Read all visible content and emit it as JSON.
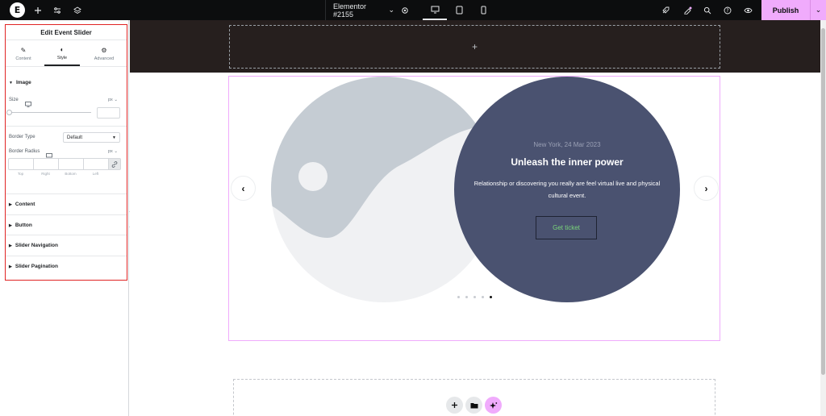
{
  "topbar": {
    "logo_letter": "E",
    "add_icon": "plus-icon",
    "settings_icon": "sliders-icon",
    "structure_icon": "layers-icon",
    "doc_title": "Elementor #2155",
    "doc_caret": "⌄",
    "doc_settings_icon": "gear-icon",
    "devices": [
      "desktop-icon",
      "tablet-icon",
      "mobile-icon"
    ],
    "right_icons": [
      "rocket-icon",
      "notes-icon",
      "search-icon",
      "help-icon",
      "preview-icon"
    ],
    "publish_label": "Publish",
    "publish_caret": "⌄"
  },
  "panel": {
    "title": "Edit Event Slider",
    "tabs": [
      {
        "label": "Content",
        "icon": "✎"
      },
      {
        "label": "Style",
        "icon": "◐"
      },
      {
        "label": "Advanced",
        "icon": "⚙"
      }
    ],
    "image_section": {
      "heading": "Image",
      "size_label": "Size",
      "size_unit": "px ⌄",
      "border_type_label": "Border Type",
      "border_type_value": "Default",
      "border_radius_label": "Border Radius",
      "border_radius_unit": "px ⌄",
      "dimension_labels": [
        "Top",
        "Right",
        "Bottom",
        "Left"
      ]
    },
    "sections": [
      "Content",
      "Button",
      "Slider Navigation",
      "Slider Pagination"
    ]
  },
  "canvas": {
    "empty_section_plus": "+",
    "slide": {
      "meta": "New York, 24 Mar 2023",
      "headline": "Unleash the inner power",
      "description": "Relationship or discovering you really are feel virtual live and physical cultural event.",
      "button_label": "Get ticket"
    },
    "prev_arrow": "‹",
    "next_arrow": "›",
    "pagination_count": 5,
    "pagination_active": 5,
    "fab_icons": [
      "plus-icon",
      "folder-icon",
      "ai-sparkle-icon"
    ]
  },
  "colors": {
    "accent_pink": "#f0abfc",
    "slide_bg": "#4a5270",
    "dark_section": "#261f1e",
    "button_text": "#7ad67a"
  }
}
